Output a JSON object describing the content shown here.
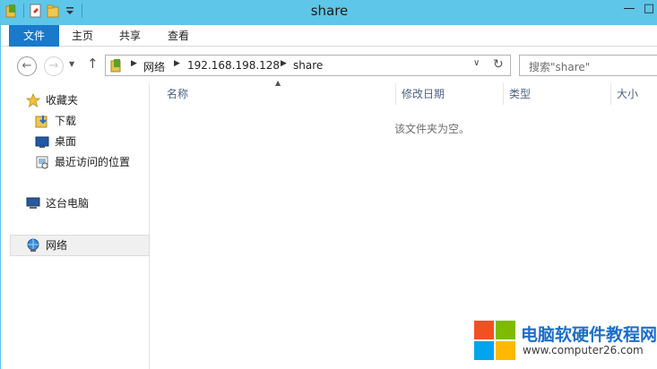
{
  "window": {
    "title": "share",
    "minimize_glyph": "—",
    "maximize_glyph": "□"
  },
  "ribbon": {
    "tabs": [
      {
        "label": "文件"
      },
      {
        "label": "主页"
      },
      {
        "label": "共享"
      },
      {
        "label": "查看"
      }
    ]
  },
  "address": {
    "breadcrumbs": [
      "网络",
      "192.168.198.128",
      "share"
    ],
    "separator": "▶"
  },
  "search": {
    "placeholder": "搜索\"share\""
  },
  "sidebar": {
    "items": [
      {
        "label": "收藏夹",
        "icon": "star-icon"
      },
      {
        "label": "下载",
        "icon": "downloads-folder-icon"
      },
      {
        "label": "桌面",
        "icon": "desktop-icon"
      },
      {
        "label": "最近访问的位置",
        "icon": "recent-places-icon"
      },
      {
        "label": "这台电脑",
        "icon": "computer-icon"
      },
      {
        "label": "网络",
        "icon": "network-icon",
        "selected": true
      }
    ]
  },
  "file_list": {
    "columns": [
      "名称",
      "修改日期",
      "类型",
      "大小"
    ],
    "empty_message": "该文件夹为空。"
  },
  "watermark": {
    "title": "电脑软硬件教程网",
    "url": "www.computer26.com",
    "colors": [
      "#f25022",
      "#7fba00",
      "#00a4ef",
      "#ffb900"
    ]
  },
  "colors": {
    "titlebar": "#5ec6e8",
    "file_tab": "#1979ca",
    "column_header_text": "#4d6185"
  }
}
